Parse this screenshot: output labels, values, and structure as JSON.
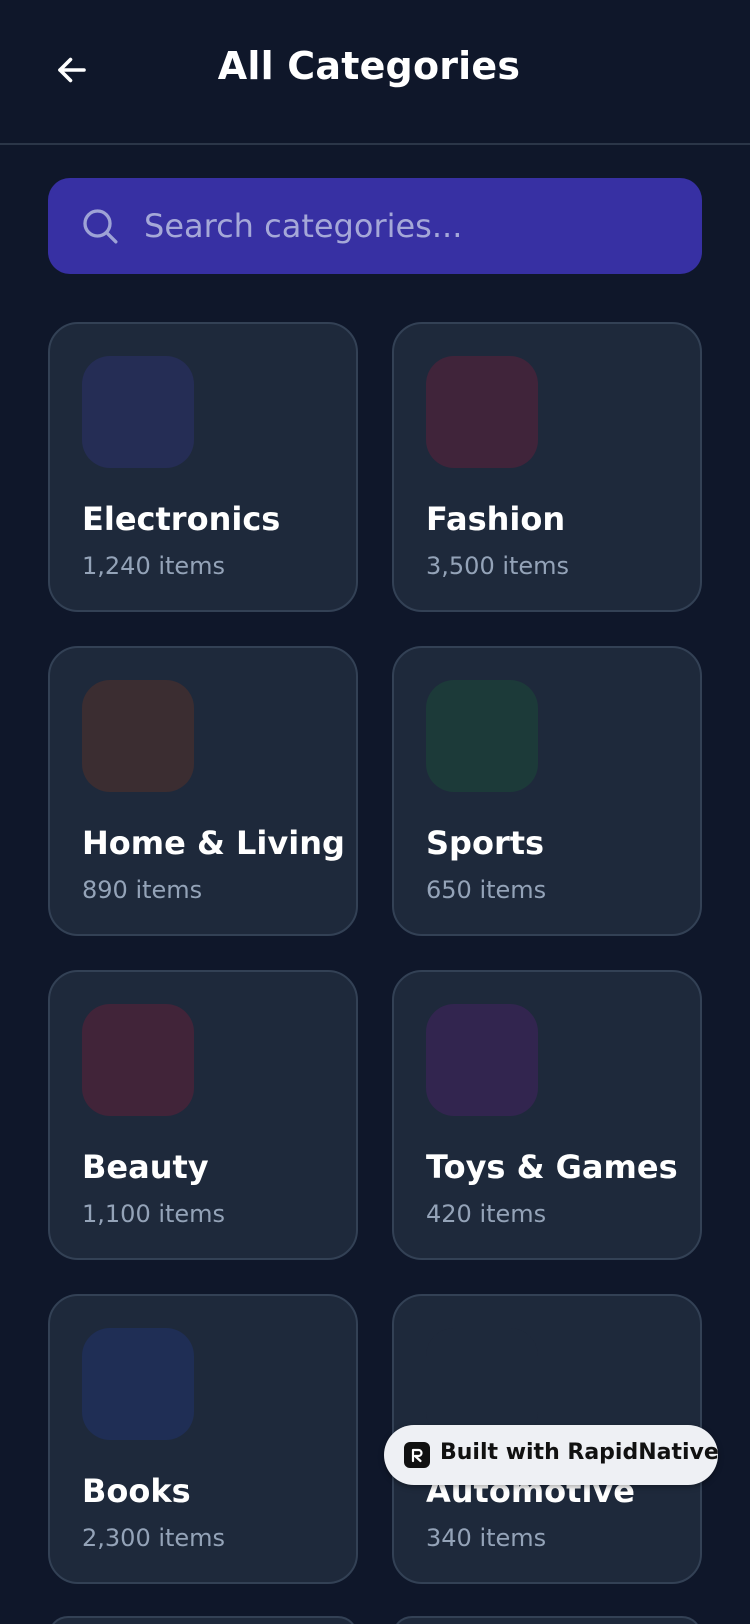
{
  "header": {
    "title": "All Categories",
    "back_icon": "arrow-left-icon"
  },
  "search": {
    "placeholder": "Search categories...",
    "value": "",
    "icon": "search-icon"
  },
  "categories": [
    {
      "name": "Electronics",
      "count": "1,240 items",
      "color": "#252d55"
    },
    {
      "name": "Fashion",
      "count": "3,500 items",
      "color": "#40243a"
    },
    {
      "name": "Home & Living",
      "count": "890 items",
      "color": "#3b2d31"
    },
    {
      "name": "Sports",
      "count": "650 items",
      "color": "#1c3a39"
    },
    {
      "name": "Beauty",
      "count": "1,100 items",
      "color": "#412439"
    },
    {
      "name": "Toys & Games",
      "count": "420 items",
      "color": "#32254f"
    },
    {
      "name": "Books",
      "count": "2,300 items",
      "color": "#1f2e55"
    },
    {
      "name": "Automotive",
      "count": "340 items",
      "color": "#1e293b"
    }
  ],
  "badge": {
    "label": "Built with RapidNative",
    "icon": "rapidnative-logo-icon"
  },
  "colors": {
    "background": "#0f172a",
    "card": "#1e293b",
    "card_border": "#334155",
    "search": "#3730a3",
    "muted_text": "#94a3b8"
  }
}
